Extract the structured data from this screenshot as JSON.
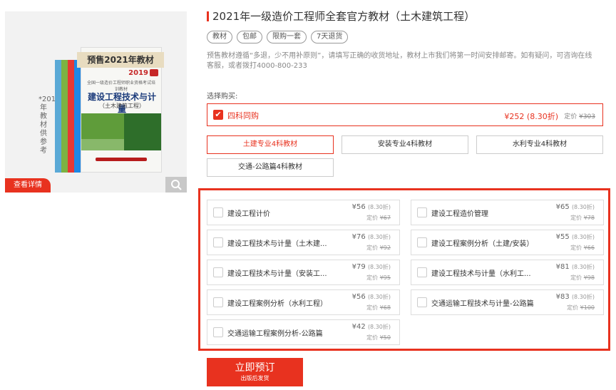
{
  "product": {
    "title": "2021年一级造价工程师全套官方教材（土木建筑工程）",
    "tags": [
      "教材",
      "包邮",
      "限购一套",
      "7天退货"
    ],
    "notice": "预售教材遵循“多退，少不用补原则”，请填写正确的收货地址，教材上市我们将第一时间安排邮寄。如有疑问，可咨询在线客服，或者拨打4000-800-233"
  },
  "image": {
    "side_note": "*2019年教材供参考",
    "ribbon": "预售2021年教材",
    "year": "2019",
    "series": "全国一级造价工程师职业资格考试培训教材",
    "book_title": "建设工程技术与计量",
    "book_subtitle": "（土木建筑工程）",
    "detail_label": "查看详情",
    "zoom_icon": "search-icon"
  },
  "purchase": {
    "label": "选择购买:",
    "combo": {
      "name": "四科同购",
      "price": "¥252",
      "discount": "(8.30折)",
      "list_label": "定价",
      "list_price": "¥303"
    },
    "options": [
      "土建专业4科教材",
      "安装专业4科教材",
      "水利专业4科教材",
      "交通-公路篇4科教材"
    ],
    "selected_option": "土建专业4科教材"
  },
  "items": [
    {
      "name": "建设工程计价",
      "price": "¥56",
      "discount": "(8.30折)",
      "list_label": "定价",
      "list_price": "¥67"
    },
    {
      "name": "建设工程造价管理",
      "price": "¥65",
      "discount": "(8.30折)",
      "list_label": "定价",
      "list_price": "¥78"
    },
    {
      "name": "建设工程技术与计量（土木建...",
      "price": "¥76",
      "discount": "(8.30折)",
      "list_label": "定价",
      "list_price": "¥92"
    },
    {
      "name": "建设工程案例分析（土建/安装）",
      "price": "¥55",
      "discount": "(8.30折)",
      "list_label": "定价",
      "list_price": "¥66"
    },
    {
      "name": "建设工程技术与计量（安装工...",
      "price": "¥79",
      "discount": "(8.30折)",
      "list_label": "定价",
      "list_price": "¥95"
    },
    {
      "name": "建设工程技术与计量（水利工...",
      "price": "¥81",
      "discount": "(8.30折)",
      "list_label": "定价",
      "list_price": "¥98"
    },
    {
      "name": "建设工程案例分析（水利工程）",
      "price": "¥56",
      "discount": "(8.30折)",
      "list_label": "定价",
      "list_price": "¥68"
    },
    {
      "name": "交通运输工程技术与计量-公路篇",
      "price": "¥83",
      "discount": "(8.30折)",
      "list_label": "定价",
      "list_price": "¥100"
    },
    {
      "name": "交通运输工程案例分析-公路篇",
      "price": "¥42",
      "discount": "(8.30折)",
      "list_label": "定价",
      "list_price": "¥50"
    }
  ],
  "buy_button": {
    "label": "立即预订",
    "sublabel": "出版后发货"
  },
  "colors": {
    "accent": "#e8321f",
    "text": "#333333",
    "muted": "#999999"
  }
}
